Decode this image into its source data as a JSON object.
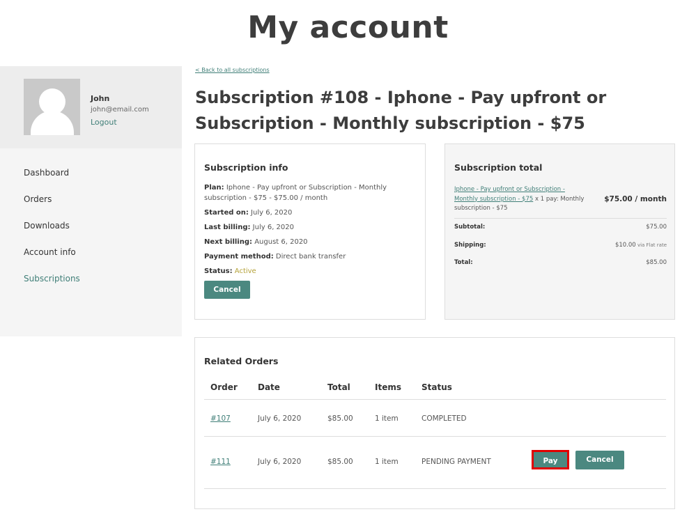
{
  "page": {
    "title": "My account"
  },
  "sidebar": {
    "user_name": "John",
    "user_email": "john@email.com",
    "logout_label": "Logout",
    "items": [
      {
        "label": "Dashboard"
      },
      {
        "label": "Orders"
      },
      {
        "label": "Downloads"
      },
      {
        "label": "Account info"
      },
      {
        "label": "Subscriptions",
        "active": true
      }
    ]
  },
  "main": {
    "back_link": "< Back to all subscriptions",
    "title": "Subscription #108 - Iphone - Pay upfront or Subscription - Monthly subscription - $75"
  },
  "subscription_info": {
    "heading": "Subscription info",
    "plan_label": "Plan:",
    "plan_value": "Iphone - Pay upfront or Subscription - Monthly subscription - $75 - $75.00 / month",
    "started_label": "Started on:",
    "started_value": "July 6, 2020",
    "last_billing_label": "Last billing:",
    "last_billing_value": "July 6, 2020",
    "next_billing_label": "Next billing:",
    "next_billing_value": "August 6, 2020",
    "payment_label": "Payment method:",
    "payment_value": "Direct bank transfer",
    "status_label": "Status:",
    "status_value": "Active",
    "cancel_label": "Cancel"
  },
  "subscription_total": {
    "heading": "Subscription total",
    "product_link": "Iphone - Pay upfront or Subscription - Monthly subscription - $75",
    "product_qty": " x 1 pay: Monthly subscription - $75",
    "product_price": "$75.00 / month",
    "subtotal_label": "Subtotal:",
    "subtotal_value": "$75.00",
    "shipping_label": "Shipping:",
    "shipping_value": "$10.00",
    "shipping_via": " via Flat rate",
    "total_label": "Total:",
    "total_value": "$85.00"
  },
  "related_orders": {
    "heading": "Related Orders",
    "columns": {
      "order": "Order",
      "date": "Date",
      "total": "Total",
      "items": "Items",
      "status": "Status"
    },
    "rows": [
      {
        "order": "#107",
        "date": "July 6, 2020",
        "total": "$85.00",
        "items": "1 item",
        "status": "COMPLETED"
      },
      {
        "order": "#111",
        "date": "July 6, 2020",
        "total": "$85.00",
        "items": "1 item",
        "status": "PENDING PAYMENT",
        "pay_label": "Pay",
        "cancel_label": "Cancel"
      }
    ]
  }
}
